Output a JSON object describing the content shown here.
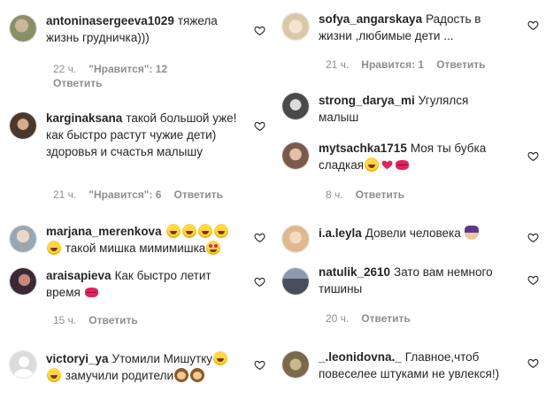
{
  "left": [
    {
      "username": "antoninasergeeva1029",
      "text": "тяжела жизнь грудничка)))",
      "time": "22 ч.",
      "likes": "\"Нравится\": 12",
      "reply": "Ответить",
      "avatar_color": "#8a8f6a"
    },
    {
      "username": "karginaksana",
      "text": "такой большой уже! как быстро растут чужие дети) здоровья и счастья малышу",
      "time": "21 ч.",
      "likes": "\"Нравится\": 6",
      "reply": "Ответить",
      "avatar_color": "#4a3a2e"
    },
    {
      "username": "marjana_merenkova",
      "text": "такой мишка мимимишка",
      "time": "",
      "likes": "",
      "reply": "",
      "avatar_color": "#9aa6b0"
    },
    {
      "username": "araisapieva",
      "text": "Как быстро летит время",
      "time": "15 ч.",
      "likes": "",
      "reply": "Ответить",
      "avatar_color": "#3b2a35"
    },
    {
      "username": "victoryi_ya",
      "text": "Утомили Мишутку",
      "text2": "замучили родители",
      "time": "",
      "likes": "",
      "reply": "",
      "avatar_color": "#dbdbdb"
    }
  ],
  "right": [
    {
      "username": "sofya_angarskaya",
      "text": "Радость в жизни ,любимые дети ...",
      "time": "21 ч.",
      "likes": "Нравится: 1",
      "reply": "Ответить",
      "avatar_color": "#d8c8a8"
    },
    {
      "username": "strong_darya_mi",
      "text": "Угулялся малыш",
      "time": "",
      "likes": "",
      "reply": "",
      "avatar_color": "#6a6a6a"
    },
    {
      "username": "mytsachka1715",
      "text": "Моя ты бубка сладкая",
      "time": "8 ч.",
      "likes": "",
      "reply": "Ответить",
      "avatar_color": "#7a5a4a"
    },
    {
      "username": "i.a.leyla",
      "text": "Довели человека",
      "time": "",
      "likes": "",
      "reply": "",
      "avatar_color": "#e0b890"
    },
    {
      "username": "natulik_2610",
      "text": "Зато вам немного тишины",
      "time": "20 ч.",
      "likes": "",
      "reply": "Ответить",
      "avatar_color": "#4a4e5a"
    },
    {
      "username": "_.leonidovna._",
      "text": "Главное,чтоб повеселее штуками не увлекся!)",
      "time": "",
      "likes": "",
      "reply": "",
      "avatar_color": "#7a6a4a"
    }
  ],
  "colors": {
    "text": "#262626",
    "meta": "#8e8e8e",
    "heart_stroke": "#262626"
  }
}
